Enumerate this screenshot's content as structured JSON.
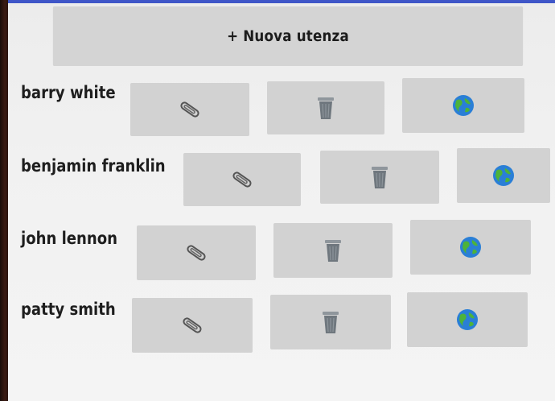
{
  "header": {
    "add_button_label": "+ Nuova utenza"
  },
  "icons": {
    "edit": "paperclip-icon",
    "delete": "trash-icon",
    "web": "globe-icon"
  },
  "colors": {
    "accent_strip": "#3f56c8",
    "button_bg": "#d2d2d2"
  },
  "users": [
    {
      "name": "barry white"
    },
    {
      "name": "benjamin franklin"
    },
    {
      "name": "john lennon"
    },
    {
      "name": "patty smith"
    }
  ]
}
